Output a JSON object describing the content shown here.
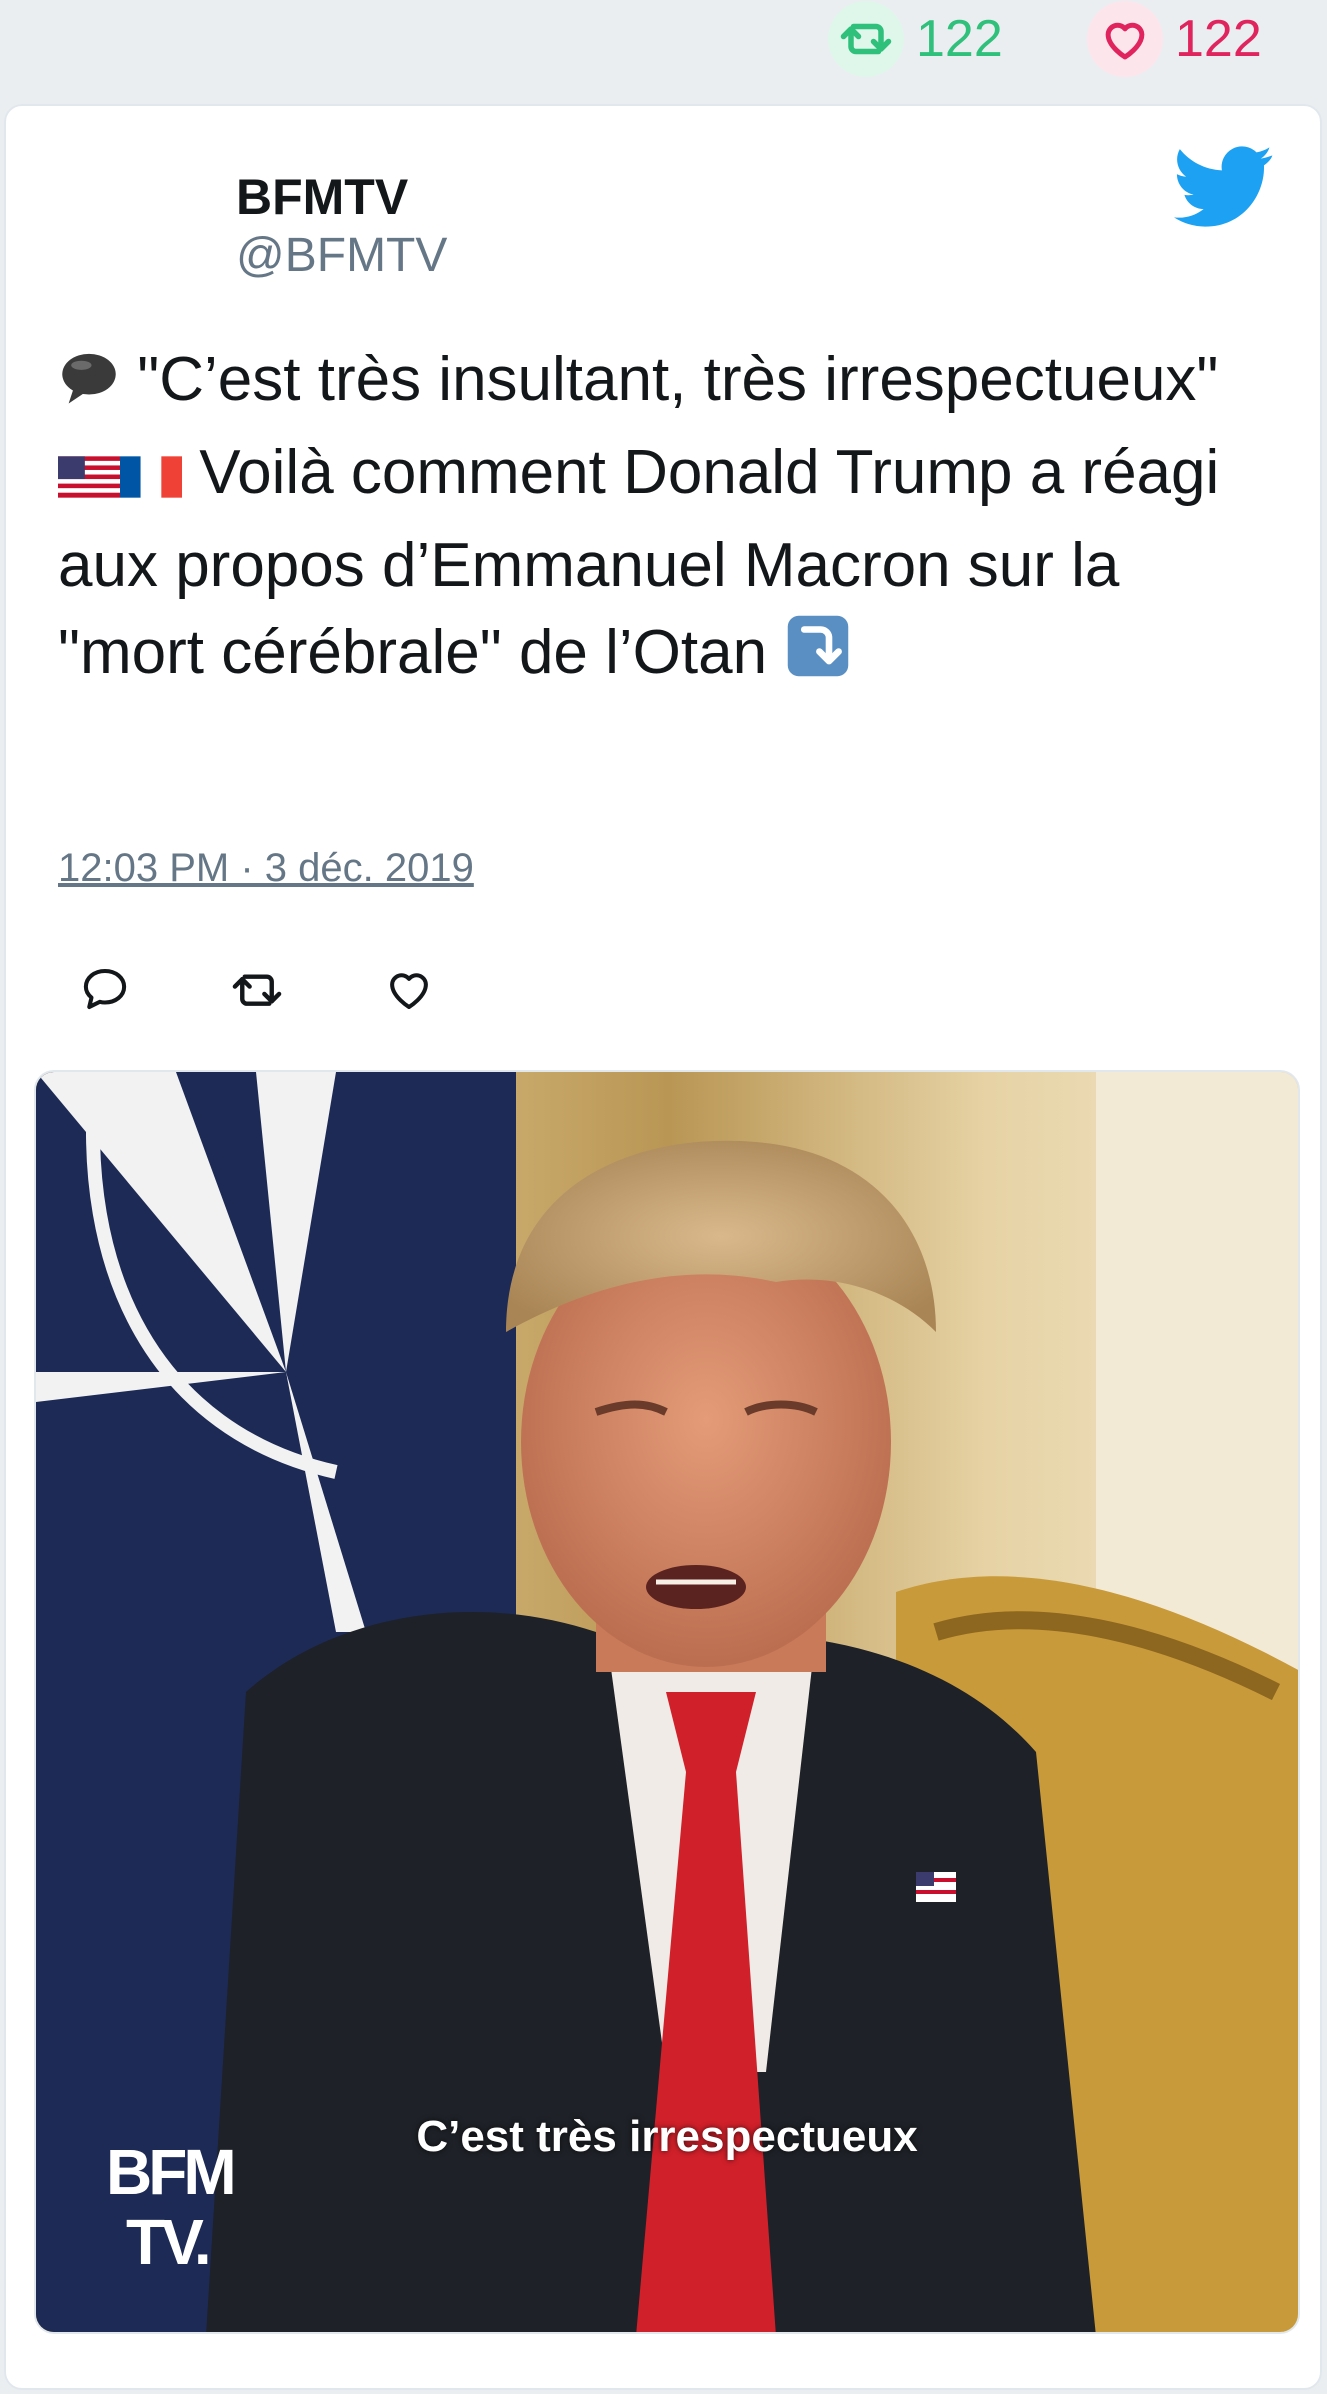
{
  "stats": {
    "retweet_count": "122",
    "like_count": "122",
    "retweet_icon": "retweet-icon",
    "like_icon": "heart-icon",
    "retweet_color": "#2fc07b",
    "like_color": "#e0245e"
  },
  "tweet": {
    "author_name": "BFMTV",
    "author_handle": "@BFMTV",
    "text_part1": " \"C’est très insultant, très irrespectueux\" ",
    "text_part2": " Voilà comment Donald Trump a réagi aux propos d’Emmanuel Macron sur la \"mort cérébrale\" de l’Otan ",
    "timestamp": "12:03 PM · 3 déc. 2019",
    "brand_icon": "twitter-bird-icon",
    "brand_color": "#1da1f2"
  },
  "actions": {
    "reply_icon": "reply-icon",
    "retweet_icon": "retweet-icon",
    "like_icon": "heart-icon"
  },
  "media": {
    "subtitle": "C’est très irrespectueux",
    "watermark": "BFM TV."
  }
}
